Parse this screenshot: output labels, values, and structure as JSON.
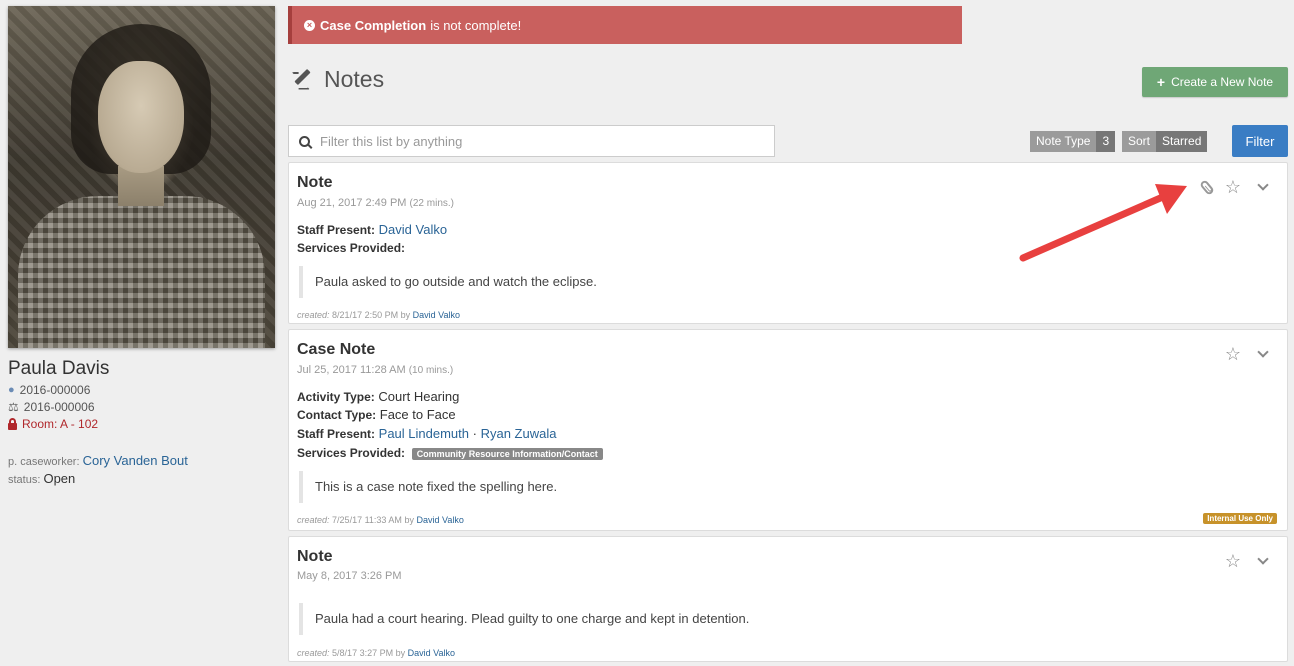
{
  "alert": {
    "bold": "Case Completion",
    "rest": "is not complete!"
  },
  "page": {
    "title": "Notes",
    "create_label": "Create a New Note"
  },
  "search": {
    "placeholder": "Filter this list by anything"
  },
  "filters": {
    "note_type_label": "Note Type",
    "note_type_count": "3",
    "sort_label": "Sort",
    "sort_value": "Starred",
    "filter_button": "Filter"
  },
  "patient": {
    "name": "Paula Davis",
    "id1": "2016-000006",
    "id2": "2016-000006",
    "room": "Room: A - 102",
    "caseworker_label": "p. caseworker:",
    "caseworker": "Cory Vanden Bout",
    "status_label": "status:",
    "status": "Open"
  },
  "notes": [
    {
      "title": "Note",
      "date": "Aug 21, 2017 2:49 PM",
      "duration": "(22 mins.)",
      "staff_label": "Staff Present:",
      "staff": "David Valko",
      "services_label": "Services Provided:",
      "body": "Paula asked to go outside and watch the eclipse.",
      "created_label": "created:",
      "created": "8/21/17 2:50 PM",
      "by": "by",
      "author": "David Valko"
    },
    {
      "title": "Case Note",
      "date": "Jul 25, 2017 11:28 AM",
      "duration": "(10 mins.)",
      "activity_label": "Activity Type:",
      "activity": "Court Hearing",
      "contact_label": "Contact Type:",
      "contact": "Face to Face",
      "staff_label": "Staff Present:",
      "staff1": "Paul Lindemuth",
      "sep": "·",
      "staff2": "Ryan Zuwala",
      "services_label": "Services Provided:",
      "service_tag": "Community Resource Information/Contact",
      "body": "This is a case note fixed the spelling here.",
      "created_label": "created:",
      "created": "7/25/17 11:33 AM",
      "by": "by",
      "author": "David Valko",
      "badge": "Internal Use Only"
    },
    {
      "title": "Note",
      "date": "May 8, 2017 3:26 PM",
      "body": "Paula had a court hearing.  Plead guilty to one charge and kept in detention.",
      "created_label": "created:",
      "created": "5/8/17 3:27 PM",
      "by": "by",
      "author": "David Valko"
    }
  ],
  "icons": {
    "star": "star-icon",
    "chevron": "chevron-down-icon",
    "attachment": "paperclip-icon"
  },
  "colors": {
    "alert": "#c9605e",
    "create": "#6fa776",
    "filter": "#3a7dc4",
    "annotation_arrow": "#e8403f"
  }
}
